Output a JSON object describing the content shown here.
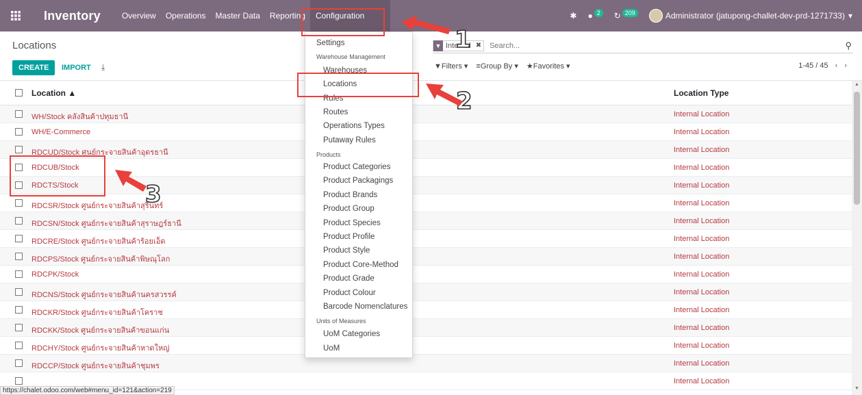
{
  "navbar": {
    "apps_icon": "grid-icon",
    "brand": "Inventory",
    "menu": [
      "Overview",
      "Operations",
      "Master Data",
      "Reporting",
      "Configuration"
    ],
    "active_menu": "Configuration",
    "bug_icon": "✱",
    "chat_icon": "●",
    "chat_count": "2",
    "activity_icon": "↻",
    "activity_count": "209",
    "user": "Administrator (jatupong-challet-dev-prd-1271733)",
    "user_caret": "▾",
    "bg_color": "#7c6a7e"
  },
  "control": {
    "breadcrumb": "Locations",
    "create_label": "CREATE",
    "import_label": "IMPORT",
    "download_icon": "⤓",
    "facet_icon": "▼",
    "facet_label": "Internal",
    "facet_remove": "✖",
    "search_placeholder": "Search...",
    "search_icon": "⚲",
    "filters_label": "▼Filters ▾",
    "groupby_label": "≡Group By ▾",
    "favorites_label": "★Favorites ▾",
    "pager": "1-45 / 45",
    "pager_prev": "‹",
    "pager_next": "›"
  },
  "table": {
    "header_location": "Location ▲",
    "header_type": "Location Type",
    "rows": [
      {
        "location": "WH/Stock คลังสินค้าปทุมธานี",
        "type": "Internal Location"
      },
      {
        "location": "WH/E-Commerce",
        "type": "Internal Location"
      },
      {
        "location": "RDCUD/Stock ศูนย์กระจายสินค้าอุดรธานี",
        "type": "Internal Location"
      },
      {
        "location": "RDCUB/Stock",
        "type": "Internal Location"
      },
      {
        "location": "RDCTS/Stock",
        "type": "Internal Location"
      },
      {
        "location": "RDCSR/Stock ศูนย์กระจายสินค้าสุรินทร์",
        "type": "Internal Location"
      },
      {
        "location": "RDCSN/Stock ศูนย์กระจายสินค้าสุราษฎร์ธานี",
        "type": "Internal Location"
      },
      {
        "location": "RDCRE/Stock ศูนย์กระจายสินค้าร้อยเอ็ด",
        "type": "Internal Location"
      },
      {
        "location": "RDCPS/Stock ศูนย์กระจายสินค้าพิษณุโลก",
        "type": "Internal Location"
      },
      {
        "location": "RDCPK/Stock",
        "type": "Internal Location"
      },
      {
        "location": "RDCNS/Stock ศูนย์กระจายสินค้านครสวรรค์",
        "type": "Internal Location"
      },
      {
        "location": "RDCKR/Stock ศูนย์กระจายสินค้าโคราช",
        "type": "Internal Location"
      },
      {
        "location": "RDCKK/Stock ศูนย์กระจายสินค้าขอนแก่น",
        "type": "Internal Location"
      },
      {
        "location": "RDCHY/Stock ศูนย์กระจายสินค้าหาดใหญ่",
        "type": "Internal Location"
      },
      {
        "location": "RDCCP/Stock ศูนย์กระจายสินค้าชุมพร",
        "type": "Internal Location"
      },
      {
        "location": "",
        "type": "Internal Location"
      }
    ]
  },
  "dropdown": {
    "items": [
      {
        "kind": "item",
        "label": "Settings"
      },
      {
        "kind": "header",
        "label": "Warehouse Management"
      },
      {
        "kind": "item",
        "label": "Warehouses",
        "indent": true
      },
      {
        "kind": "item",
        "label": "Locations",
        "indent": true
      },
      {
        "kind": "item",
        "label": "Rules",
        "indent": true
      },
      {
        "kind": "item",
        "label": "Routes",
        "indent": true
      },
      {
        "kind": "item",
        "label": "Operations Types",
        "indent": true
      },
      {
        "kind": "item",
        "label": "Putaway Rules",
        "indent": true
      },
      {
        "kind": "header",
        "label": "Products"
      },
      {
        "kind": "item",
        "label": "Product Categories",
        "indent": true
      },
      {
        "kind": "item",
        "label": "Product Packagings",
        "indent": true
      },
      {
        "kind": "item",
        "label": "Product Brands",
        "indent": true
      },
      {
        "kind": "item",
        "label": "Product Group",
        "indent": true
      },
      {
        "kind": "item",
        "label": "Product Species",
        "indent": true
      },
      {
        "kind": "item",
        "label": "Product Profile",
        "indent": true
      },
      {
        "kind": "item",
        "label": "Product Style",
        "indent": true
      },
      {
        "kind": "item",
        "label": "Product Core-Method",
        "indent": true
      },
      {
        "kind": "item",
        "label": "Product Grade",
        "indent": true
      },
      {
        "kind": "item",
        "label": "Product Colour",
        "indent": true
      },
      {
        "kind": "item",
        "label": "Barcode Nomenclatures",
        "indent": true
      },
      {
        "kind": "header",
        "label": "Units of Measures"
      },
      {
        "kind": "item",
        "label": "UoM Categories",
        "indent": true
      },
      {
        "kind": "item",
        "label": "UoM",
        "indent": true
      }
    ]
  },
  "statusbar": "https://chalet.odoo.com/web#menu_id=121&action=219",
  "annotations": {
    "num1": "1",
    "num2": "2",
    "num3": "3",
    "color": "#e8403a"
  }
}
